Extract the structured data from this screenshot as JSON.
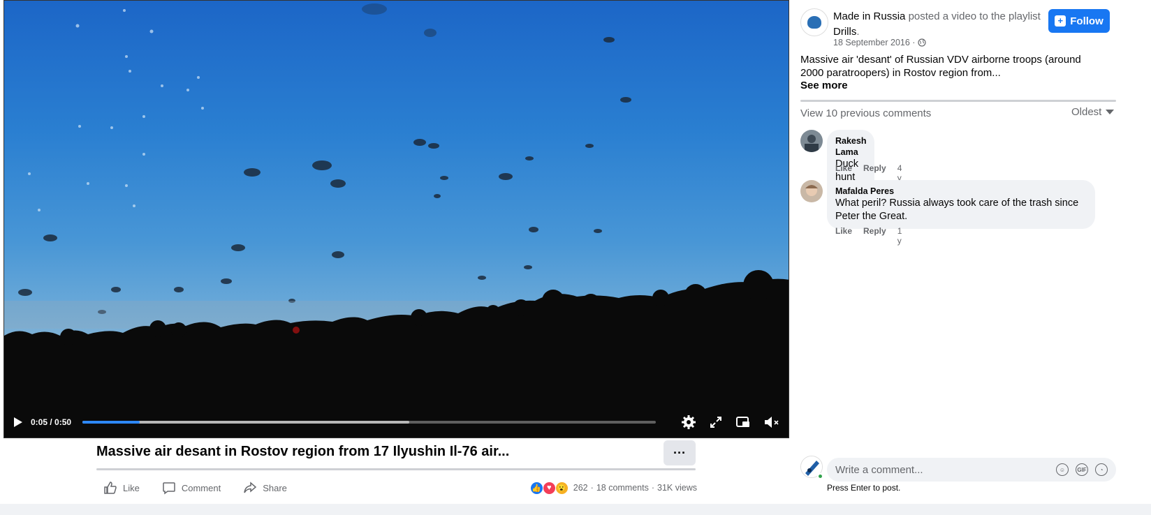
{
  "video": {
    "time_display": "0:05 / 0:50",
    "progress_fraction": 0.1,
    "buffered_fraction": 0.57,
    "title": "Massive air desant in Rostov region from 17 Ilyushin Il-76 air...",
    "more_label": "···"
  },
  "actions": {
    "like": "Like",
    "comment": "Comment",
    "share": "Share"
  },
  "stats": {
    "reactions_count": "262",
    "separator": "·",
    "comments": "18 comments",
    "views": "31K views"
  },
  "post": {
    "page_name": "Made in Russia",
    "posted_text": "posted a video to the playlist",
    "playlist": "Drills",
    "date": "18 September 2016 ·",
    "follow_label": "Follow",
    "text": "Massive air 'desant' of Russian VDV airborne troops (around 2000 paratroopers) in Rostov region from...",
    "see_more": "See more",
    "avatar_tag": "MADE IN RUSSIA"
  },
  "comments_section": {
    "view_previous": "View 10 previous comments",
    "sort_label": "Oldest",
    "comments": [
      {
        "name": "Rakesh Lama",
        "text": "Duck hunt",
        "emoji": "😊",
        "like": "Like",
        "reply": "Reply",
        "age": "4 y"
      },
      {
        "name": "Mafalda Peres",
        "text": "What peril? Russia always took care of the trash since Peter the Great.",
        "like": "Like",
        "reply": "Reply",
        "age": "1 y"
      }
    ],
    "composer_placeholder": "Write a comment...",
    "press_enter": "Press Enter to post."
  },
  "colors": {
    "accent": "#1877f2",
    "secondary_text": "#65676b",
    "bubble": "#f0f2f5"
  }
}
